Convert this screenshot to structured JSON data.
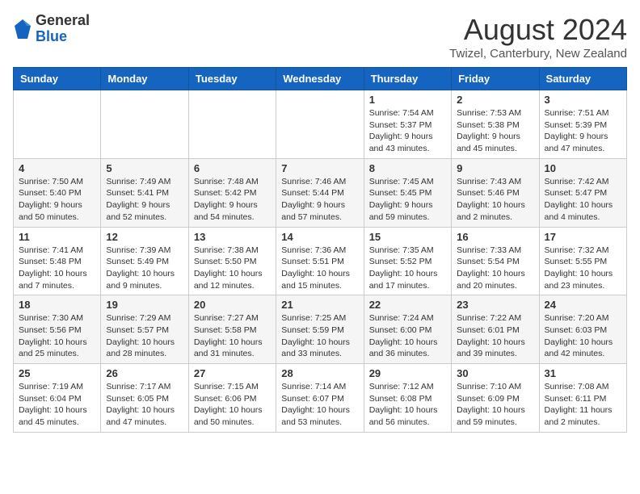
{
  "logo": {
    "general": "General",
    "blue": "Blue"
  },
  "header": {
    "month": "August 2024",
    "location": "Twizel, Canterbury, New Zealand"
  },
  "weekdays": [
    "Sunday",
    "Monday",
    "Tuesday",
    "Wednesday",
    "Thursday",
    "Friday",
    "Saturday"
  ],
  "weeks": [
    [
      {
        "day": "",
        "info": ""
      },
      {
        "day": "",
        "info": ""
      },
      {
        "day": "",
        "info": ""
      },
      {
        "day": "",
        "info": ""
      },
      {
        "day": "1",
        "info": "Sunrise: 7:54 AM\nSunset: 5:37 PM\nDaylight: 9 hours\nand 43 minutes."
      },
      {
        "day": "2",
        "info": "Sunrise: 7:53 AM\nSunset: 5:38 PM\nDaylight: 9 hours\nand 45 minutes."
      },
      {
        "day": "3",
        "info": "Sunrise: 7:51 AM\nSunset: 5:39 PM\nDaylight: 9 hours\nand 47 minutes."
      }
    ],
    [
      {
        "day": "4",
        "info": "Sunrise: 7:50 AM\nSunset: 5:40 PM\nDaylight: 9 hours\nand 50 minutes."
      },
      {
        "day": "5",
        "info": "Sunrise: 7:49 AM\nSunset: 5:41 PM\nDaylight: 9 hours\nand 52 minutes."
      },
      {
        "day": "6",
        "info": "Sunrise: 7:48 AM\nSunset: 5:42 PM\nDaylight: 9 hours\nand 54 minutes."
      },
      {
        "day": "7",
        "info": "Sunrise: 7:46 AM\nSunset: 5:44 PM\nDaylight: 9 hours\nand 57 minutes."
      },
      {
        "day": "8",
        "info": "Sunrise: 7:45 AM\nSunset: 5:45 PM\nDaylight: 9 hours\nand 59 minutes."
      },
      {
        "day": "9",
        "info": "Sunrise: 7:43 AM\nSunset: 5:46 PM\nDaylight: 10 hours\nand 2 minutes."
      },
      {
        "day": "10",
        "info": "Sunrise: 7:42 AM\nSunset: 5:47 PM\nDaylight: 10 hours\nand 4 minutes."
      }
    ],
    [
      {
        "day": "11",
        "info": "Sunrise: 7:41 AM\nSunset: 5:48 PM\nDaylight: 10 hours\nand 7 minutes."
      },
      {
        "day": "12",
        "info": "Sunrise: 7:39 AM\nSunset: 5:49 PM\nDaylight: 10 hours\nand 9 minutes."
      },
      {
        "day": "13",
        "info": "Sunrise: 7:38 AM\nSunset: 5:50 PM\nDaylight: 10 hours\nand 12 minutes."
      },
      {
        "day": "14",
        "info": "Sunrise: 7:36 AM\nSunset: 5:51 PM\nDaylight: 10 hours\nand 15 minutes."
      },
      {
        "day": "15",
        "info": "Sunrise: 7:35 AM\nSunset: 5:52 PM\nDaylight: 10 hours\nand 17 minutes."
      },
      {
        "day": "16",
        "info": "Sunrise: 7:33 AM\nSunset: 5:54 PM\nDaylight: 10 hours\nand 20 minutes."
      },
      {
        "day": "17",
        "info": "Sunrise: 7:32 AM\nSunset: 5:55 PM\nDaylight: 10 hours\nand 23 minutes."
      }
    ],
    [
      {
        "day": "18",
        "info": "Sunrise: 7:30 AM\nSunset: 5:56 PM\nDaylight: 10 hours\nand 25 minutes."
      },
      {
        "day": "19",
        "info": "Sunrise: 7:29 AM\nSunset: 5:57 PM\nDaylight: 10 hours\nand 28 minutes."
      },
      {
        "day": "20",
        "info": "Sunrise: 7:27 AM\nSunset: 5:58 PM\nDaylight: 10 hours\nand 31 minutes."
      },
      {
        "day": "21",
        "info": "Sunrise: 7:25 AM\nSunset: 5:59 PM\nDaylight: 10 hours\nand 33 minutes."
      },
      {
        "day": "22",
        "info": "Sunrise: 7:24 AM\nSunset: 6:00 PM\nDaylight: 10 hours\nand 36 minutes."
      },
      {
        "day": "23",
        "info": "Sunrise: 7:22 AM\nSunset: 6:01 PM\nDaylight: 10 hours\nand 39 minutes."
      },
      {
        "day": "24",
        "info": "Sunrise: 7:20 AM\nSunset: 6:03 PM\nDaylight: 10 hours\nand 42 minutes."
      }
    ],
    [
      {
        "day": "25",
        "info": "Sunrise: 7:19 AM\nSunset: 6:04 PM\nDaylight: 10 hours\nand 45 minutes."
      },
      {
        "day": "26",
        "info": "Sunrise: 7:17 AM\nSunset: 6:05 PM\nDaylight: 10 hours\nand 47 minutes."
      },
      {
        "day": "27",
        "info": "Sunrise: 7:15 AM\nSunset: 6:06 PM\nDaylight: 10 hours\nand 50 minutes."
      },
      {
        "day": "28",
        "info": "Sunrise: 7:14 AM\nSunset: 6:07 PM\nDaylight: 10 hours\nand 53 minutes."
      },
      {
        "day": "29",
        "info": "Sunrise: 7:12 AM\nSunset: 6:08 PM\nDaylight: 10 hours\nand 56 minutes."
      },
      {
        "day": "30",
        "info": "Sunrise: 7:10 AM\nSunset: 6:09 PM\nDaylight: 10 hours\nand 59 minutes."
      },
      {
        "day": "31",
        "info": "Sunrise: 7:08 AM\nSunset: 6:11 PM\nDaylight: 11 hours\nand 2 minutes."
      }
    ]
  ]
}
